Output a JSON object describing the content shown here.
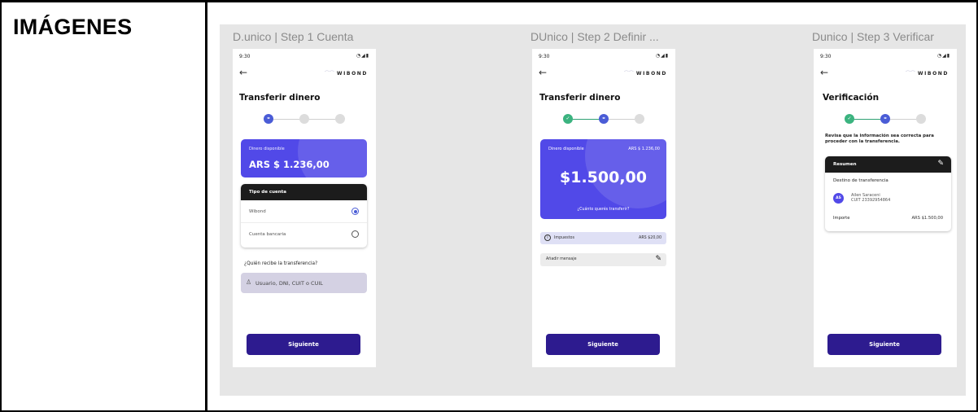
{
  "section_title": "IMÁGENES",
  "frames": [
    {
      "label": "D.unico | Step 1 Cuenta",
      "status_time": "9:30",
      "status_icons": "◔◢▮",
      "brand": "WIBOND",
      "back_arrow": "←",
      "title": "Transferir dinero",
      "balance_label": "Dinero disponible",
      "balance_amount": "ARS $ 1.236,00",
      "account_type_title": "Tipo de cuenta",
      "account_options": [
        {
          "label": "Wibond",
          "selected": true
        },
        {
          "label": "Cuenta bancaria",
          "selected": false
        }
      ],
      "question": "¿Quién recibe la transferencia?",
      "search_placeholder": "Usuario, DNI, CUIT o CUIL",
      "cta": "Siguiente"
    },
    {
      "label": "DUnico | Step 2 Definir ...",
      "status_time": "9:30",
      "status_icons": "◔◢▮",
      "brand": "WIBOND",
      "back_arrow": "←",
      "title": "Transferir dinero",
      "balance_label": "Dinero disponible",
      "balance_right": "ARS $ 1.236,00",
      "big_amount": "$1.500,00",
      "amount_hint": "¿Cuánto querés transferir?",
      "tax_label": "Impuestos",
      "tax_value": "ARS $20,00",
      "message_label": "Añadir mensaje",
      "cta": "Siguiente"
    },
    {
      "label": "Dunico | Step 3 Verificar",
      "status_time": "9:30",
      "status_icons": "◔◢▮",
      "brand": "WIBOND",
      "back_arrow": "←",
      "title": "Verificación",
      "intro": "Revisa que la información sea correcta para proceder con la transferencia.",
      "summary_title": "Resumen",
      "destination_label": "Destino de transferencia",
      "avatar_initials": "AS",
      "recipient_name": "Ailen Saraceni",
      "recipient_cuit": "CUIT 23392954864",
      "amount_label": "Importe",
      "amount_value": "ARS $1.500,00",
      "cta": "Siguiente"
    }
  ],
  "colors": {
    "primary": "#5149e8",
    "cta": "#2d1b8f",
    "step_active": "#4a5cd6",
    "step_done": "#3bb37f"
  }
}
